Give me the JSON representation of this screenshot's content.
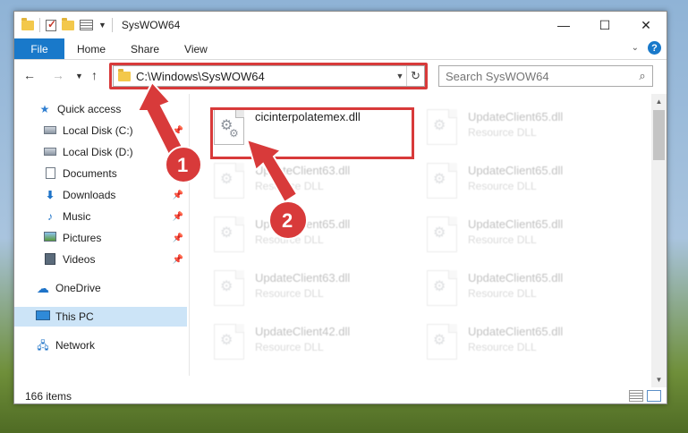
{
  "window": {
    "title": "SysWOW64",
    "controls": {
      "minimize": "—",
      "maximize": "☐",
      "close": "✕"
    }
  },
  "ribbon": {
    "tabs": [
      "File",
      "Home",
      "Share",
      "View"
    ]
  },
  "navigation": {
    "address": "C:\\Windows\\SysWOW64",
    "search_placeholder": "Search SysWOW64"
  },
  "sidebar": {
    "items": [
      {
        "label": "Quick access",
        "icon": "star-icon"
      },
      {
        "label": "Local Disk (C:)",
        "icon": "disk-icon"
      },
      {
        "label": "Local Disk (D:)",
        "icon": "disk-icon"
      },
      {
        "label": "Documents",
        "icon": "documents-icon"
      },
      {
        "label": "Downloads",
        "icon": "download-icon"
      },
      {
        "label": "Music",
        "icon": "music-icon"
      },
      {
        "label": "Pictures",
        "icon": "pictures-icon"
      },
      {
        "label": "Videos",
        "icon": "videos-icon"
      },
      {
        "label": "OneDrive",
        "icon": "cloud-icon"
      },
      {
        "label": "This PC",
        "icon": "pc-icon"
      },
      {
        "label": "Network",
        "icon": "network-icon"
      }
    ],
    "active": "This PC"
  },
  "files": {
    "highlighted": {
      "name": "cicinterpolatemex.dll"
    },
    "items": [
      {
        "name": "UpdateClient65.dll",
        "type": "Resource DLL"
      },
      {
        "name": "UpdateClient63.dll",
        "type": "Resource DLL"
      },
      {
        "name": "UpdateClient65.dll",
        "type": "Resource DLL"
      },
      {
        "name": "UpdateClient65.dll",
        "type": "Resource DLL"
      },
      {
        "name": "UpdateClient65.dll",
        "type": "Resource DLL"
      },
      {
        "name": "UpdateClient63.dll",
        "type": "Resource DLL"
      },
      {
        "name": "UpdateClient65.dll",
        "type": "Resource DLL"
      },
      {
        "name": "UpdateClient42.dll",
        "type": "Resource DLL"
      },
      {
        "name": "UpdateClient65.dll",
        "type": "Resource DLL"
      }
    ]
  },
  "status": {
    "count": "166 items"
  },
  "annotations": {
    "step1": "1",
    "step2": "2",
    "color": "#d83a3a"
  }
}
